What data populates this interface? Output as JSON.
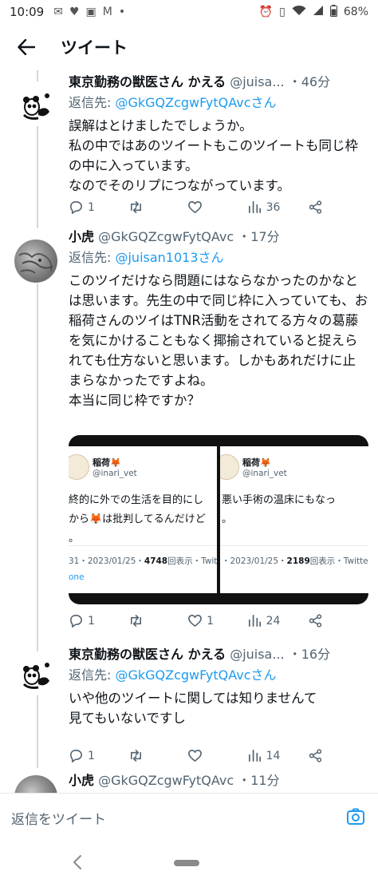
{
  "status_bar": {
    "time": "10:09",
    "battery": "68%",
    "left_icons": [
      "mail-icon",
      "heart-icon",
      "news-icon",
      "gmail-icon",
      "dot-icon"
    ],
    "right_icons": [
      "alarm-icon",
      "vibrate-icon",
      "wifi-icon",
      "signal-icon",
      "battery-icon"
    ]
  },
  "app_bar": {
    "title": "ツイート"
  },
  "tweets": [
    {
      "name": "東京勤務の獣医さん かえる",
      "handle": "@juisa...",
      "time": "・46分",
      "reply_prefix": "返信先: ",
      "reply_to": "@GkGQZcgwFytQAvcさん",
      "text": "誤解はとけましたでしょうか。\n私の中ではあのツイートもこのツイートも同じ枠の中に入っています。\nなのでそのリプにつながっています。",
      "replies": "1",
      "retweets": "",
      "likes": "",
      "views": "36"
    },
    {
      "name": "小虎",
      "handle": "@GkGQZcgwFytQAvc",
      "time": "・17分",
      "reply_prefix": "返信先: ",
      "reply_to": "@juisan1013さん",
      "text": "このツイだけなら問題にはならなかったのかなとは思います。先生の中で同じ枠に入っていても、お稲荷さんのツイはTNR活動をされてる方々の葛藤を気にかけることもなく揶揄されていると捉えられても仕方ないと思います。しかもあれだけに止まらなかったですよね。\n本当に同じ枠ですか？",
      "media": [
        {
          "name": "稲荷🦊",
          "handle": "@inari_vet",
          "line1": "終的に外での生活を目的にし",
          "line2": "から🦊は批判してるんだけど",
          "line3": "。",
          "meta_prefix": "31・2023/01/25・",
          "views": "4748",
          "meta_suffix": "回表示・Twitter fo",
          "link": "one"
        },
        {
          "name": "稲荷🦊",
          "handle": "@inari_vet",
          "line1": "悪い手術の温床にもなっ",
          "line2": "。",
          "line3": "",
          "meta_prefix": "・2023/01/25・",
          "views": "2189",
          "meta_suffix": "回表示・Twitte",
          "link": ""
        }
      ],
      "replies": "1",
      "retweets": "",
      "likes": "1",
      "views": "24"
    },
    {
      "name": "東京勤務の獣医さん かえる",
      "handle": "@juisa...",
      "time": "・16分",
      "reply_prefix": "返信先: ",
      "reply_to": "@GkGQZcgwFytQAvcさん",
      "text": "いや他のツイートに関しては知りませんて\n見てもいないですし",
      "replies": "1",
      "retweets": "",
      "likes": "",
      "views": "14"
    },
    {
      "name": "小虎",
      "handle": "@GkGQZcgwFytQAvc",
      "time": "・11分"
    }
  ],
  "composer": {
    "placeholder": "返信をツイート"
  }
}
